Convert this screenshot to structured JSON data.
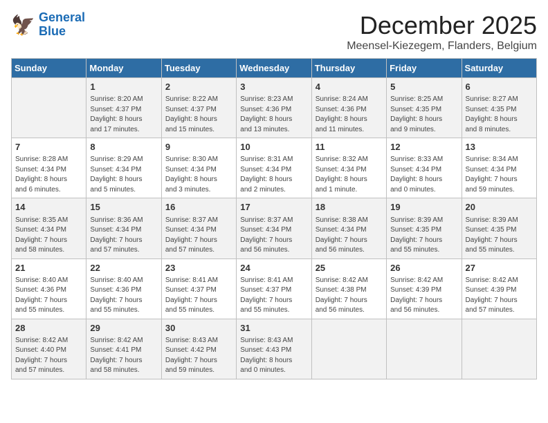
{
  "header": {
    "logo_line1": "General",
    "logo_line2": "Blue",
    "month": "December 2025",
    "location": "Meensel-Kiezegem, Flanders, Belgium"
  },
  "days_of_week": [
    "Sunday",
    "Monday",
    "Tuesday",
    "Wednesday",
    "Thursday",
    "Friday",
    "Saturday"
  ],
  "weeks": [
    [
      {
        "day": "",
        "info": ""
      },
      {
        "day": "1",
        "info": "Sunrise: 8:20 AM\nSunset: 4:37 PM\nDaylight: 8 hours\nand 17 minutes."
      },
      {
        "day": "2",
        "info": "Sunrise: 8:22 AM\nSunset: 4:37 PM\nDaylight: 8 hours\nand 15 minutes."
      },
      {
        "day": "3",
        "info": "Sunrise: 8:23 AM\nSunset: 4:36 PM\nDaylight: 8 hours\nand 13 minutes."
      },
      {
        "day": "4",
        "info": "Sunrise: 8:24 AM\nSunset: 4:36 PM\nDaylight: 8 hours\nand 11 minutes."
      },
      {
        "day": "5",
        "info": "Sunrise: 8:25 AM\nSunset: 4:35 PM\nDaylight: 8 hours\nand 9 minutes."
      },
      {
        "day": "6",
        "info": "Sunrise: 8:27 AM\nSunset: 4:35 PM\nDaylight: 8 hours\nand 8 minutes."
      }
    ],
    [
      {
        "day": "7",
        "info": "Sunrise: 8:28 AM\nSunset: 4:34 PM\nDaylight: 8 hours\nand 6 minutes."
      },
      {
        "day": "8",
        "info": "Sunrise: 8:29 AM\nSunset: 4:34 PM\nDaylight: 8 hours\nand 5 minutes."
      },
      {
        "day": "9",
        "info": "Sunrise: 8:30 AM\nSunset: 4:34 PM\nDaylight: 8 hours\nand 3 minutes."
      },
      {
        "day": "10",
        "info": "Sunrise: 8:31 AM\nSunset: 4:34 PM\nDaylight: 8 hours\nand 2 minutes."
      },
      {
        "day": "11",
        "info": "Sunrise: 8:32 AM\nSunset: 4:34 PM\nDaylight: 8 hours\nand 1 minute."
      },
      {
        "day": "12",
        "info": "Sunrise: 8:33 AM\nSunset: 4:34 PM\nDaylight: 8 hours\nand 0 minutes."
      },
      {
        "day": "13",
        "info": "Sunrise: 8:34 AM\nSunset: 4:34 PM\nDaylight: 7 hours\nand 59 minutes."
      }
    ],
    [
      {
        "day": "14",
        "info": "Sunrise: 8:35 AM\nSunset: 4:34 PM\nDaylight: 7 hours\nand 58 minutes."
      },
      {
        "day": "15",
        "info": "Sunrise: 8:36 AM\nSunset: 4:34 PM\nDaylight: 7 hours\nand 57 minutes."
      },
      {
        "day": "16",
        "info": "Sunrise: 8:37 AM\nSunset: 4:34 PM\nDaylight: 7 hours\nand 57 minutes."
      },
      {
        "day": "17",
        "info": "Sunrise: 8:37 AM\nSunset: 4:34 PM\nDaylight: 7 hours\nand 56 minutes."
      },
      {
        "day": "18",
        "info": "Sunrise: 8:38 AM\nSunset: 4:34 PM\nDaylight: 7 hours\nand 56 minutes."
      },
      {
        "day": "19",
        "info": "Sunrise: 8:39 AM\nSunset: 4:35 PM\nDaylight: 7 hours\nand 55 minutes."
      },
      {
        "day": "20",
        "info": "Sunrise: 8:39 AM\nSunset: 4:35 PM\nDaylight: 7 hours\nand 55 minutes."
      }
    ],
    [
      {
        "day": "21",
        "info": "Sunrise: 8:40 AM\nSunset: 4:36 PM\nDaylight: 7 hours\nand 55 minutes."
      },
      {
        "day": "22",
        "info": "Sunrise: 8:40 AM\nSunset: 4:36 PM\nDaylight: 7 hours\nand 55 minutes."
      },
      {
        "day": "23",
        "info": "Sunrise: 8:41 AM\nSunset: 4:37 PM\nDaylight: 7 hours\nand 55 minutes."
      },
      {
        "day": "24",
        "info": "Sunrise: 8:41 AM\nSunset: 4:37 PM\nDaylight: 7 hours\nand 55 minutes."
      },
      {
        "day": "25",
        "info": "Sunrise: 8:42 AM\nSunset: 4:38 PM\nDaylight: 7 hours\nand 56 minutes."
      },
      {
        "day": "26",
        "info": "Sunrise: 8:42 AM\nSunset: 4:39 PM\nDaylight: 7 hours\nand 56 minutes."
      },
      {
        "day": "27",
        "info": "Sunrise: 8:42 AM\nSunset: 4:39 PM\nDaylight: 7 hours\nand 57 minutes."
      }
    ],
    [
      {
        "day": "28",
        "info": "Sunrise: 8:42 AM\nSunset: 4:40 PM\nDaylight: 7 hours\nand 57 minutes."
      },
      {
        "day": "29",
        "info": "Sunrise: 8:42 AM\nSunset: 4:41 PM\nDaylight: 7 hours\nand 58 minutes."
      },
      {
        "day": "30",
        "info": "Sunrise: 8:43 AM\nSunset: 4:42 PM\nDaylight: 7 hours\nand 59 minutes."
      },
      {
        "day": "31",
        "info": "Sunrise: 8:43 AM\nSunset: 4:43 PM\nDaylight: 8 hours\nand 0 minutes."
      },
      {
        "day": "",
        "info": ""
      },
      {
        "day": "",
        "info": ""
      },
      {
        "day": "",
        "info": ""
      }
    ]
  ]
}
